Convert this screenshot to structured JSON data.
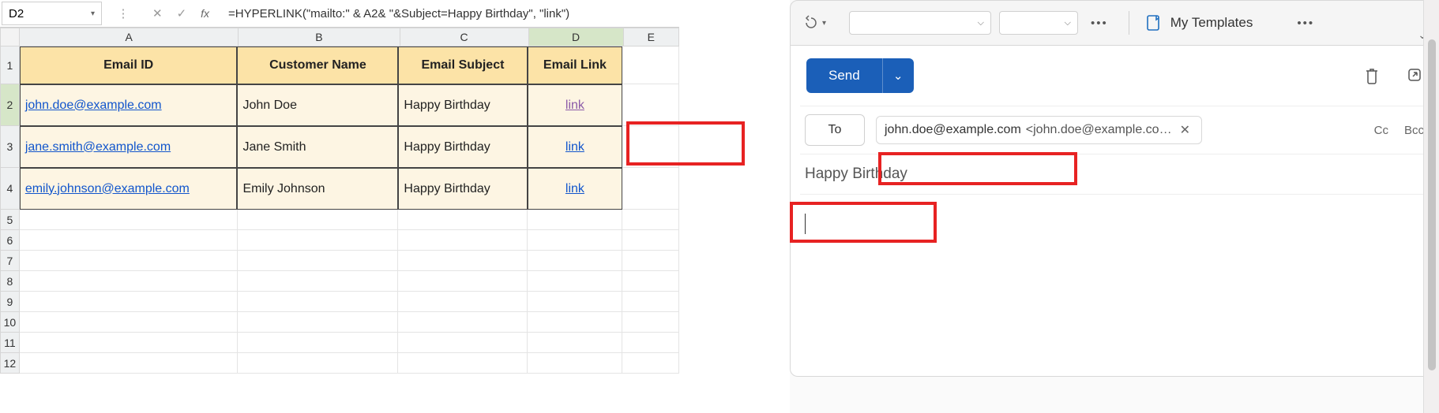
{
  "formula_bar": {
    "cell_ref": "D2",
    "fx": "fx",
    "formula": "=HYPERLINK(\"mailto:\" & A2& \"&Subject=Happy Birthday\", \"link\")"
  },
  "columns": [
    "A",
    "B",
    "C",
    "D",
    "E"
  ],
  "row_numbers": [
    "1",
    "2",
    "3",
    "4",
    "5",
    "6",
    "7",
    "8",
    "9",
    "10",
    "11",
    "12"
  ],
  "headers": {
    "email_id": "Email ID",
    "customer_name": "Customer Name",
    "email_subject": "Email Subject",
    "email_link": "Email Link"
  },
  "rows": [
    {
      "email": "john.doe@example.com",
      "name": "John Doe",
      "subject": "Happy Birthday",
      "link": "link"
    },
    {
      "email": "jane.smith@example.com",
      "name": "Jane Smith",
      "subject": "Happy Birthday",
      "link": "link"
    },
    {
      "email": "emily.johnson@example.com",
      "name": "Emily Johnson",
      "subject": "Happy Birthday",
      "link": "link"
    }
  ],
  "outlook": {
    "templates_label": "My Templates",
    "send": "Send",
    "to_label": "To",
    "to_email_display": "john.doe@example.com",
    "to_email_full": "<john.doe@example.co…",
    "cc": "Cc",
    "bcc": "Bcc",
    "subject": "Happy Birthday"
  }
}
